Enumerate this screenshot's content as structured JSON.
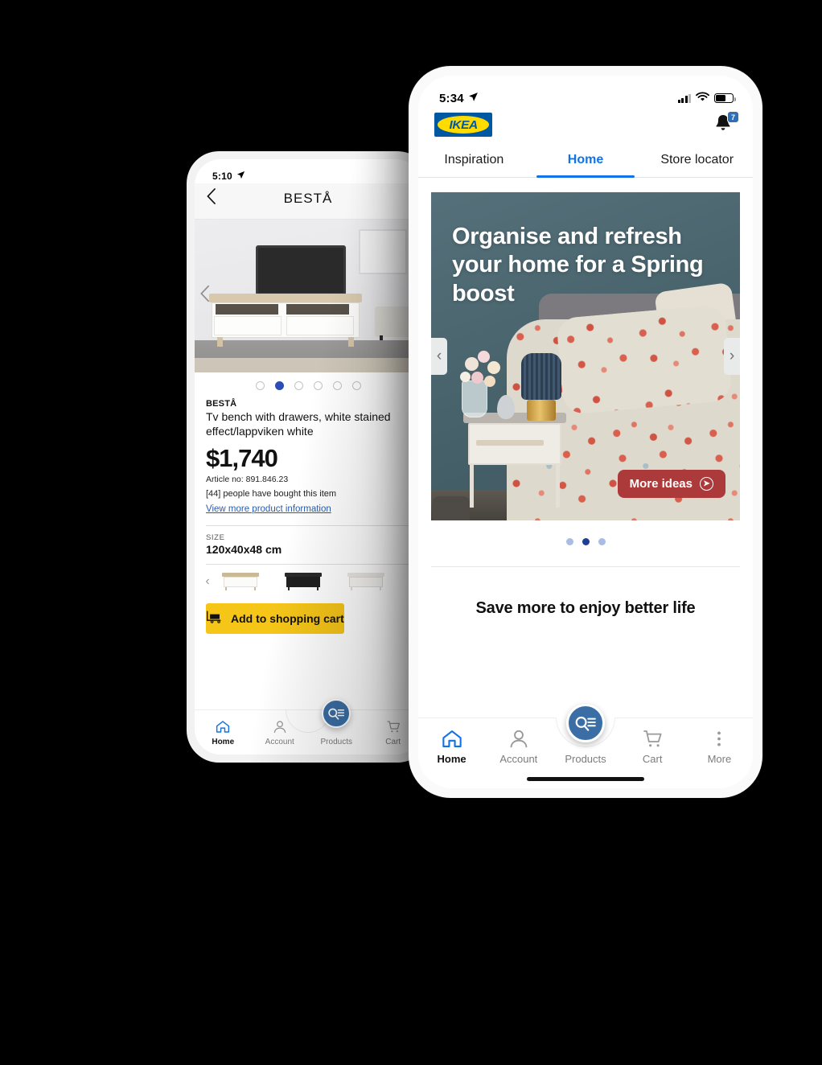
{
  "background_color": "#000000",
  "front_phone": {
    "status_bar": {
      "time": "5:34",
      "location_icon": "location-arrow-icon",
      "signal_icon": "cellular-bars-icon",
      "wifi_icon": "wifi-icon",
      "battery_icon": "battery-icon"
    },
    "app_bar": {
      "logo_text": "IKEA",
      "logo_bg": "#0058a3",
      "logo_ellipse": "#ffdb00",
      "bell_icon": "notification-bell-icon",
      "badge_count": "7",
      "badge_color": "#2f6fb5"
    },
    "tabs": [
      {
        "label": "Inspiration",
        "active": false
      },
      {
        "label": "Home",
        "active": true
      },
      {
        "label": "Store locator",
        "active": false
      }
    ],
    "accent_color": "#1273e6",
    "hero": {
      "title": "Organise and refresh your home for a Spring boost",
      "cta_label": "More ideas",
      "cta_color": "#ad3a3a",
      "cta_icon": "circle-arrow-right-icon",
      "prev_icon": "chevron-left-icon",
      "next_icon": "chevron-right-icon",
      "background_color": "#4e686f"
    },
    "carousel": {
      "total": 3,
      "active_index": 1,
      "active_color": "#1d3f94",
      "inactive_color": "#a9bde2"
    },
    "section_title": "Save more to enjoy better life",
    "tabbar": [
      {
        "label": "Home",
        "icon": "home-icon",
        "active": true
      },
      {
        "label": "Account",
        "icon": "person-icon",
        "active": false
      },
      {
        "label": "Products",
        "icon": "search-list-icon",
        "active": false
      },
      {
        "label": "Cart",
        "icon": "shopping-cart-icon",
        "active": false
      },
      {
        "label": "More",
        "icon": "more-vertical-icon",
        "active": false
      }
    ],
    "fab_color": "#3a6ea5"
  },
  "back_phone": {
    "status_bar": {
      "time": "5:10",
      "location_icon": "location-arrow-icon"
    },
    "nav": {
      "back_icon": "chevron-left-icon",
      "title": "BESTÅ"
    },
    "image_carousel": {
      "total": 6,
      "active_index": 1,
      "prev_icon": "chevron-left-icon",
      "active_color": "#2c4db3"
    },
    "product": {
      "brand": "BESTÅ",
      "description": "Tv bench with drawers, white stained effect/lappviken white",
      "price": "$1,740",
      "article_no": "Article no: 891.846.23",
      "bought_text": "[44] people have bought this item",
      "more_info_link": "View more product information",
      "size_label": "SIZE",
      "size_value": "120x40x48 cm"
    },
    "variants": {
      "prev_icon": "chevron-left-icon",
      "items": [
        "oak-white-bench",
        "black-bench",
        "white-bench"
      ]
    },
    "cart_button": {
      "label": "Add to shopping cart",
      "icon": "trolley-icon",
      "color": "#f5c518"
    },
    "tabbar": [
      {
        "label": "Home",
        "icon": "home-icon",
        "active": true
      },
      {
        "label": "Account",
        "icon": "person-icon",
        "active": false
      },
      {
        "label": "Products",
        "icon": "search-list-icon",
        "active": false
      },
      {
        "label": "Cart",
        "icon": "shopping-cart-icon",
        "active": false
      }
    ]
  }
}
